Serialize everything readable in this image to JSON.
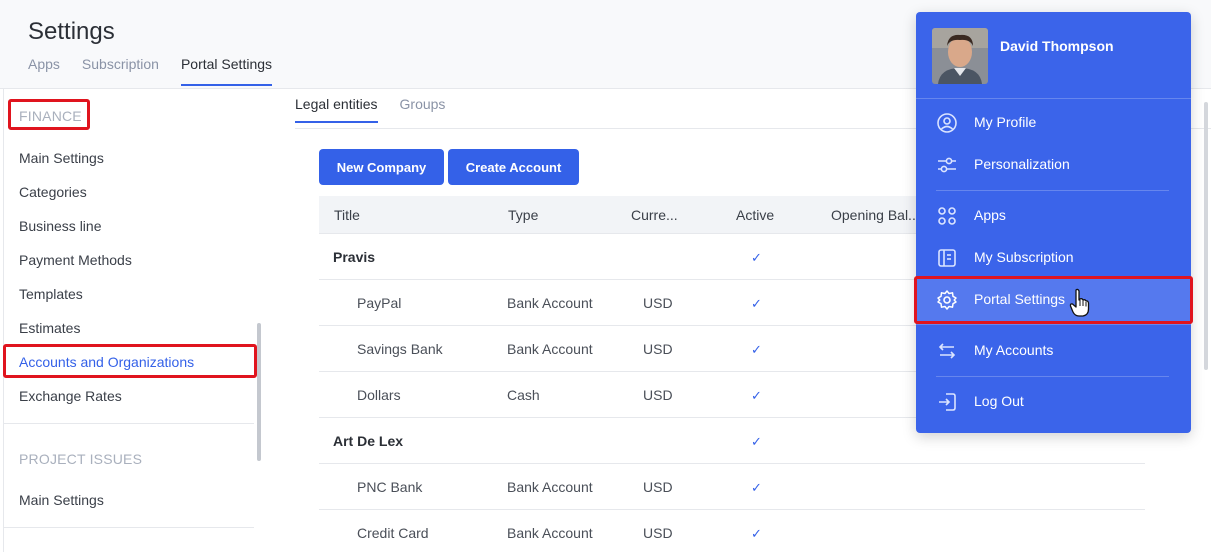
{
  "header": {
    "title": "Settings",
    "tabs": [
      "Apps",
      "Subscription",
      "Portal Settings"
    ]
  },
  "sidebar": {
    "finance_label": "FINANCE",
    "finance_items": [
      "Main Settings",
      "Categories",
      "Business line",
      "Payment Methods",
      "Templates",
      "Estimates",
      "Accounts and Organizations",
      "Exchange Rates"
    ],
    "project_label": "PROJECT ISSUES",
    "project_items": [
      "Main Settings"
    ]
  },
  "content": {
    "tabs": [
      "Legal entities",
      "Groups"
    ],
    "buttons": {
      "new_company": "New Company",
      "create_account": "Create Account"
    },
    "columns": [
      "Title",
      "Type",
      "Curre...",
      "Active",
      "Opening Bal..."
    ],
    "rows": [
      {
        "kind": "group",
        "title": "Pravis",
        "type": "",
        "currency": "",
        "active": "✓"
      },
      {
        "kind": "item",
        "title": "PayPal",
        "type": "Bank Account",
        "currency": "USD",
        "active": "✓"
      },
      {
        "kind": "item",
        "title": "Savings Bank",
        "type": "Bank Account",
        "currency": "USD",
        "active": "✓"
      },
      {
        "kind": "item",
        "title": "Dollars",
        "type": "Cash",
        "currency": "USD",
        "active": "✓"
      },
      {
        "kind": "group",
        "title": "Art De Lex",
        "type": "",
        "currency": "",
        "active": "✓"
      },
      {
        "kind": "item",
        "title": "PNC Bank",
        "type": "Bank Account",
        "currency": "USD",
        "active": "✓"
      },
      {
        "kind": "item",
        "title": "Credit Card",
        "type": "Bank Account",
        "currency": "USD",
        "active": "✓"
      }
    ]
  },
  "user_menu": {
    "name": "David Thompson",
    "items": [
      {
        "label": "My Profile",
        "icon": "user-circle-icon"
      },
      {
        "label": "Personalization",
        "icon": "sliders-icon"
      },
      {
        "label": "Apps",
        "icon": "apps-grid-icon"
      },
      {
        "label": "My Subscription",
        "icon": "subscription-icon"
      },
      {
        "label": "Portal Settings",
        "icon": "gear-icon"
      },
      {
        "label": "My Accounts",
        "icon": "switch-arrows-icon"
      },
      {
        "label": "Log Out",
        "icon": "logout-icon"
      }
    ]
  },
  "colors": {
    "accent": "#3461e8",
    "menu_bg": "#3b64ea",
    "highlight": "#e0141e"
  }
}
